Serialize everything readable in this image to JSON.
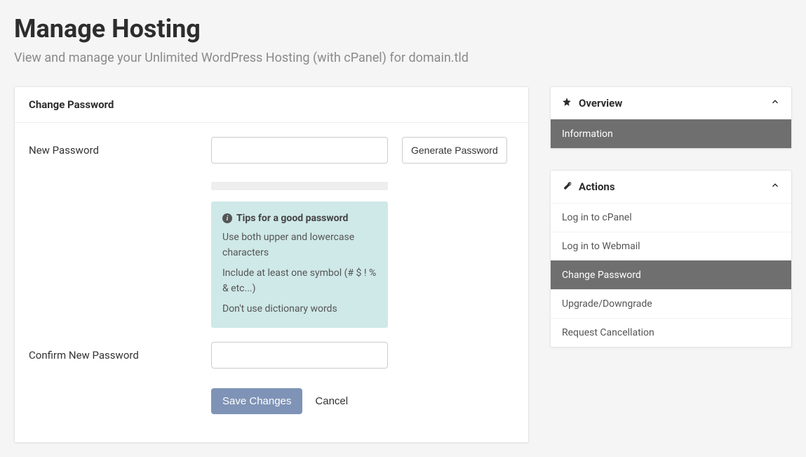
{
  "page": {
    "title": "Manage Hosting",
    "subtitle": "View and manage your Unlimited WordPress Hosting (with cPanel) for domain.tld"
  },
  "form": {
    "panel_title": "Change Password",
    "new_password_label": "New Password",
    "new_password_value": "",
    "generate_button": "Generate Password",
    "tips_heading": "Tips for a good password",
    "tip1": "Use both upper and lowercase characters",
    "tip2": "Include at least one symbol (# $ ! % & etc...)",
    "tip3": "Don't use dictionary words",
    "confirm_label": "Confirm New Password",
    "confirm_value": "",
    "save_label": "Save Changes",
    "cancel_label": "Cancel"
  },
  "sidebar": {
    "overview": {
      "title": "Overview",
      "items": {
        "information": "Information"
      }
    },
    "actions": {
      "title": "Actions",
      "items": {
        "cpanel": "Log in to cPanel",
        "webmail": "Log in to Webmail",
        "change_password": "Change Password",
        "upgrade": "Upgrade/Downgrade",
        "cancel": "Request Cancellation"
      }
    }
  }
}
